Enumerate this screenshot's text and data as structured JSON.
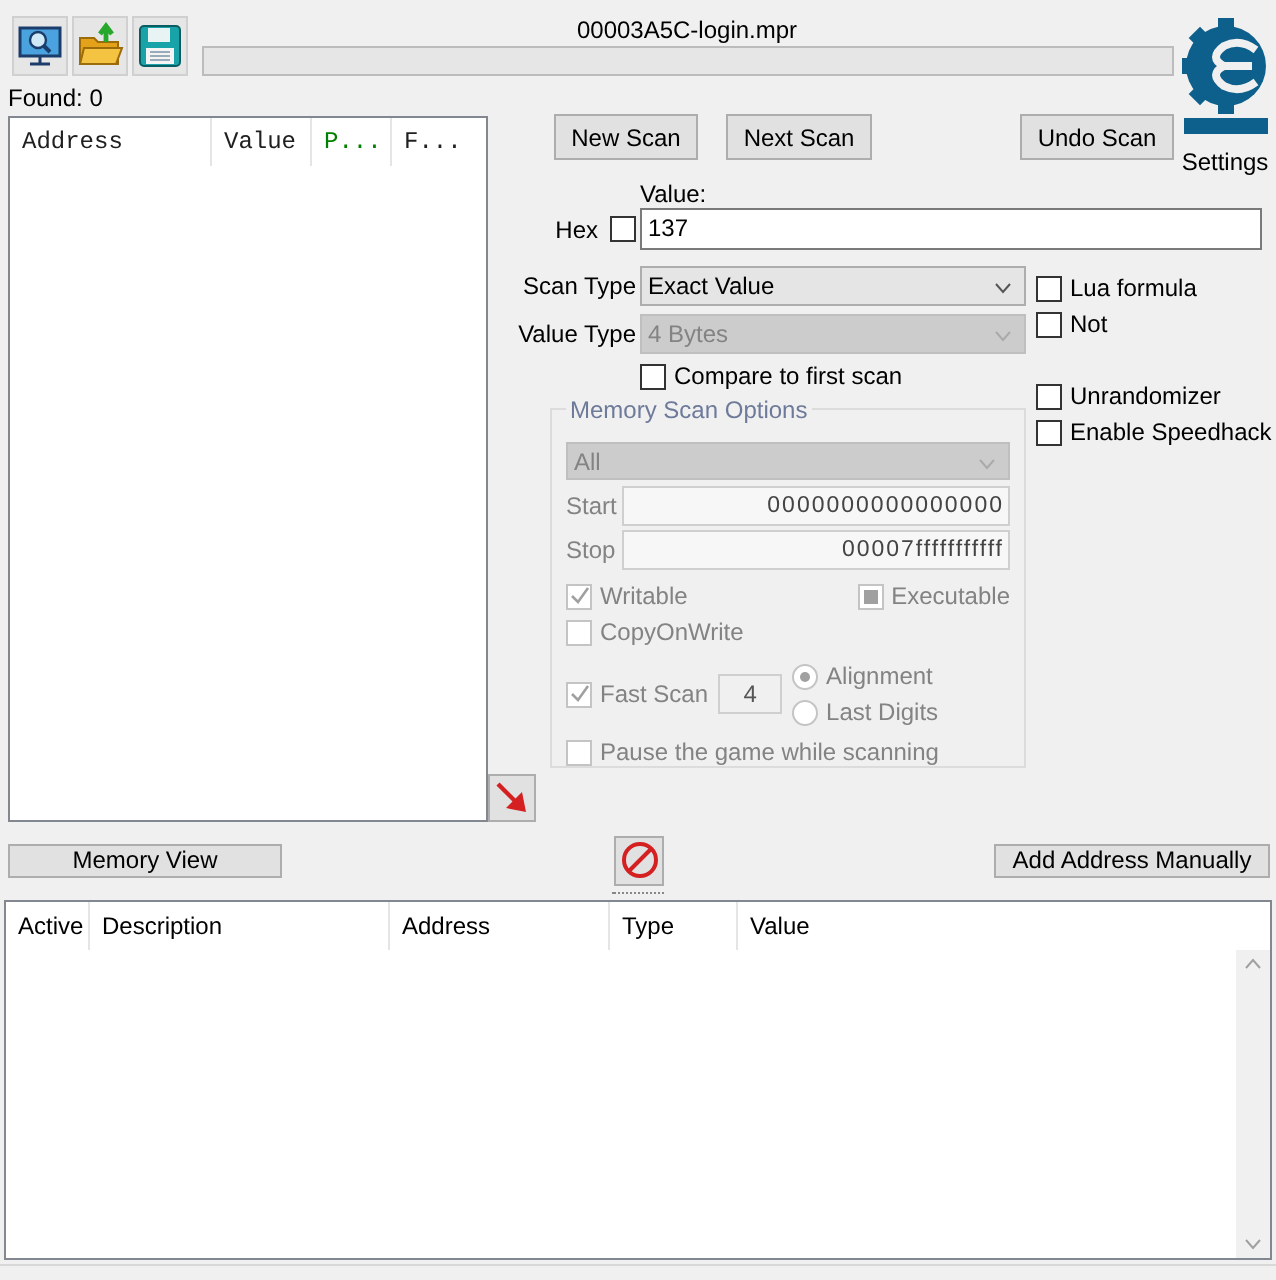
{
  "window": {
    "title": "00003A5C-login.mpr"
  },
  "scan_progress": {
    "level": 0
  },
  "logo": {
    "caption": "Settings"
  },
  "found": "Found: 0",
  "scan_list": {
    "columns": [
      {
        "label": "Address",
        "color": "#202020"
      },
      {
        "label": "Value",
        "color": "#202020"
      },
      {
        "label": "P...",
        "color": "#008000"
      },
      {
        "label": "F...",
        "color": "#202020"
      }
    ]
  },
  "scan_buttons": [
    {
      "label": "New Scan"
    },
    {
      "label": "Next Scan"
    },
    {
      "label": "Undo Scan"
    }
  ],
  "value": {
    "label": "Value:",
    "hex_label": "Hex",
    "hex_checked": false,
    "value": "137"
  },
  "scan_type": {
    "label": "Scan Type",
    "value": "Exact Value",
    "disabled": false
  },
  "value_type": {
    "label": "Value Type",
    "value": "4 Bytes",
    "disabled": true
  },
  "compare_first": {
    "label": "Compare to first scan",
    "checked": false
  },
  "formula_options": [
    {
      "label": "Lua formula",
      "checked": false
    },
    {
      "label": "Not",
      "checked": false
    }
  ],
  "extra_options": [
    {
      "label": "Unrandomizer",
      "checked": false
    },
    {
      "label": "Enable Speedhack",
      "checked": false
    }
  ],
  "memory_scan_options": {
    "title": "Memory Scan Options",
    "disabled": true,
    "region": "All",
    "start_label": "Start",
    "start": "0000000000000000",
    "stop_label": "Stop",
    "stop": "00007fffffffffff",
    "protection": [
      {
        "label": "Writable",
        "checked": true,
        "indeterminate": false
      },
      {
        "label": "Executable",
        "checked": false,
        "indeterminate": true
      },
      {
        "label": "CopyOnWrite",
        "checked": false,
        "indeterminate": false
      }
    ],
    "fast_scan": {
      "label": "Fast Scan",
      "checked": true,
      "value": "4"
    },
    "alignment": [
      {
        "label": "Alignment",
        "selected": true
      },
      {
        "label": "Last Digits",
        "selected": false
      }
    ],
    "pause": {
      "label": "Pause the game while scanning",
      "checked": false
    }
  },
  "memory_view_button": "Memory View",
  "add_address_button": "Add Address Manually",
  "address_list": {
    "columns": [
      "Active",
      "Description",
      "Address",
      "Type",
      "Value"
    ]
  }
}
